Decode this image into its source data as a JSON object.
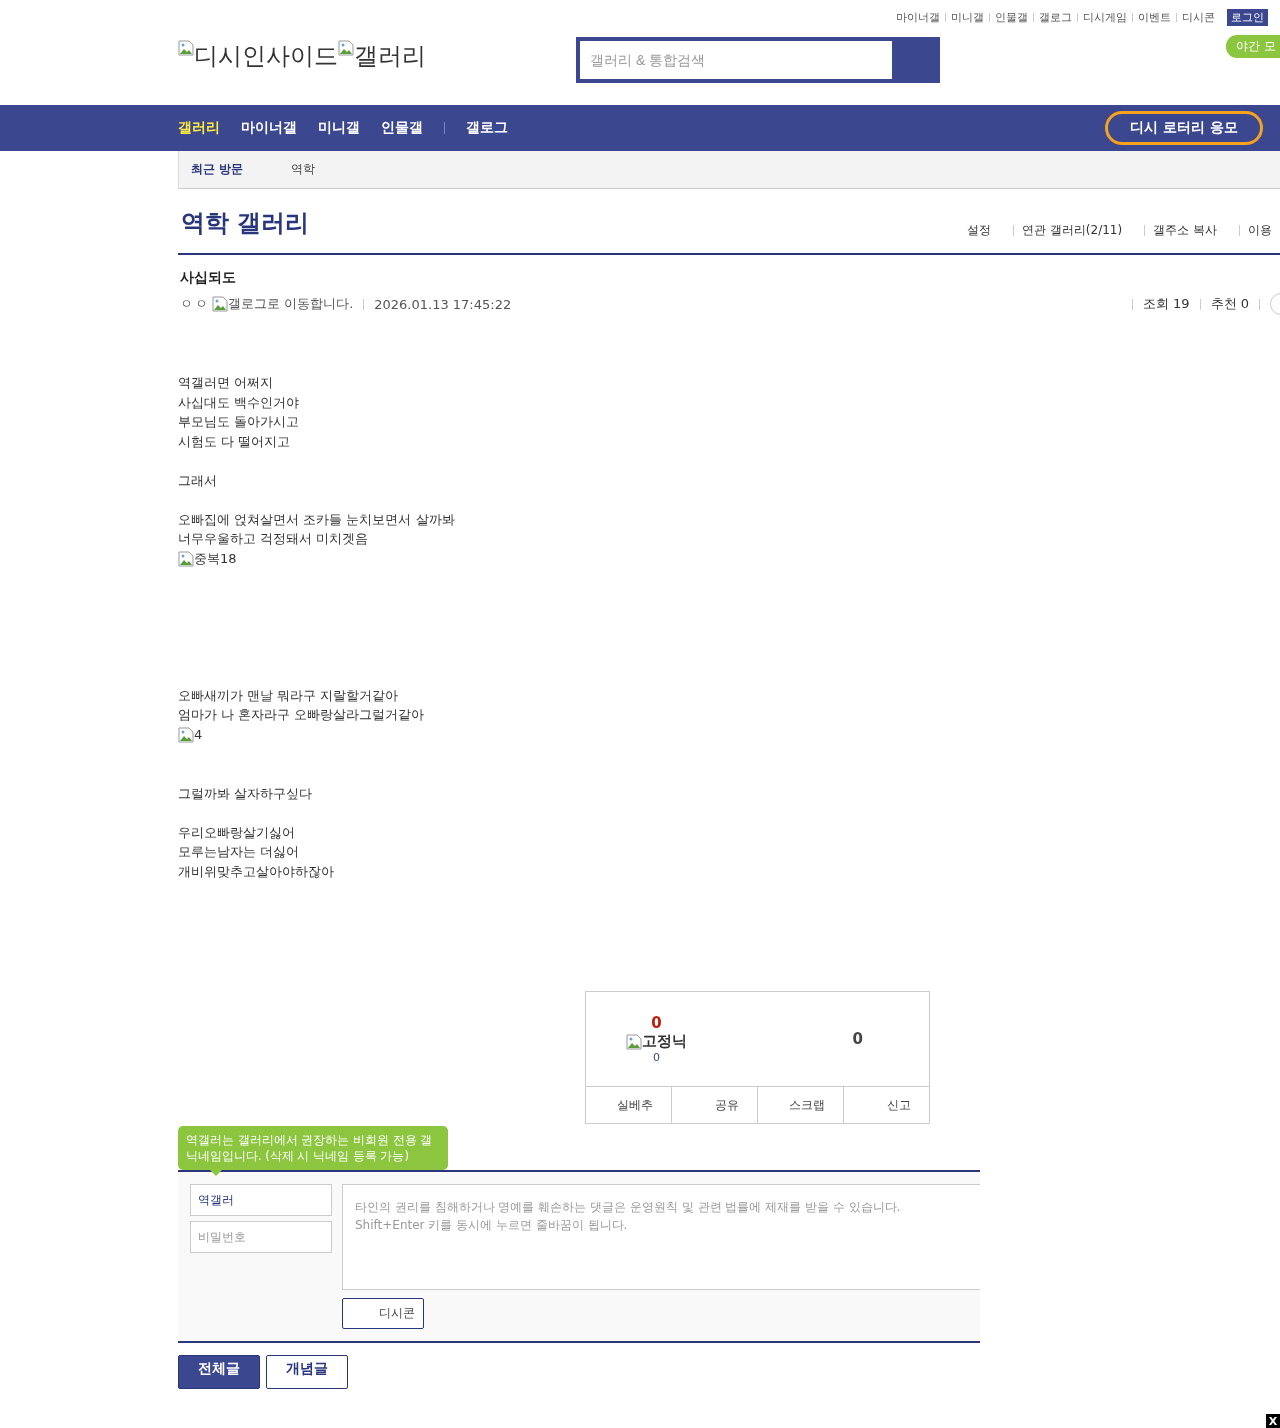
{
  "top_links": [
    "마이너갤",
    "미니갤",
    "인물갤",
    "갤로그",
    "디시게임",
    "이벤트",
    "디시콘"
  ],
  "login": "로그인",
  "night_mode": "야간 모",
  "logo": {
    "site_alt": "디시인사이드",
    "gallery_alt": "갤러리"
  },
  "search": {
    "placeholder": "갤러리 & 통합검색"
  },
  "nav": [
    {
      "label": "갤러리",
      "selected": true
    },
    {
      "label": "마이너갤",
      "selected": false
    },
    {
      "label": "미니갤",
      "selected": false
    },
    {
      "label": "인물갤",
      "selected": false
    },
    {
      "label": "갤로그",
      "selected": false
    }
  ],
  "lottery_button": "디시 로터리 응모",
  "recent": {
    "label": "최근 방문",
    "items": [
      "역학"
    ]
  },
  "gallery_title": "역학 갤러리",
  "gallery_links": [
    "설정",
    "연관 갤러리(2/11)",
    "갤주소 복사",
    "이용"
  ],
  "post": {
    "title": "사십되도",
    "author": "ㅇㅇ",
    "gallog_alt": "갤로그로 이동합니다.",
    "date": "2026.01.13 17:45:22",
    "views": "조회 19",
    "recommends": "추천 0",
    "body": [
      {
        "kind": "text",
        "text": "역갤러면 어쩌지"
      },
      {
        "kind": "text",
        "text": "사십대도 백수인거야"
      },
      {
        "kind": "text",
        "text": "부모님도 돌아가시고"
      },
      {
        "kind": "text",
        "text": "시험도 다 떨어지고"
      },
      {
        "kind": "gap"
      },
      {
        "kind": "text",
        "text": "그래서"
      },
      {
        "kind": "gap"
      },
      {
        "kind": "text",
        "text": "오빠집에 얹쳐살면서 조카들 눈치보면서 살까봐"
      },
      {
        "kind": "text",
        "text": "너무우울하고 걱정돼서 미치겟음"
      },
      {
        "kind": "image",
        "alt": "중복18"
      },
      {
        "kind": "gap"
      },
      {
        "kind": "gap"
      },
      {
        "kind": "gap"
      },
      {
        "kind": "gap"
      },
      {
        "kind": "gap"
      },
      {
        "kind": "gap"
      },
      {
        "kind": "text",
        "text": "오빠새끼가 맨날 뭐라구 지랄할거같아"
      },
      {
        "kind": "text",
        "text": "엄마가 나 혼자라구 오빠랑살라그럴거같아"
      },
      {
        "kind": "image",
        "alt": "4"
      },
      {
        "kind": "gap"
      },
      {
        "kind": "gap"
      },
      {
        "kind": "text",
        "text": "그럴까봐 살자하구싶다"
      },
      {
        "kind": "gap"
      },
      {
        "kind": "text",
        "text": "우리오빠랑살기싫어"
      },
      {
        "kind": "text",
        "text": "모루는남자는 더싫어"
      },
      {
        "kind": "text",
        "text": "개비위맞추고살아야하잖아"
      }
    ]
  },
  "recommend_box": {
    "up_count": "0",
    "fixed_nick_alt": "고정닉",
    "fixed_count": "0",
    "down_count": "0",
    "actions": [
      "실베추",
      "공유",
      "스크랩",
      "신고"
    ]
  },
  "comment": {
    "tooltip": "역갤러는 갤러리에서 권장하는 비회원 전용 갤닉네임입니다. (삭제 시 닉네임 등록 가능)",
    "nickname": "역갤러",
    "password_placeholder": "비밀번호",
    "textarea_placeholder": "타인의 권리를 침해하거나 명예를 훼손하는 댓글은 운영원칙 및 관련 법률에 제재를 받을 수 있습니다.\nShift+Enter 키를 동시에 누르면 줄바꿈이 됩니다.",
    "dccon_button": "디시콘"
  },
  "list_tabs": [
    {
      "label": "전체글",
      "selected": true
    },
    {
      "label": "개념글",
      "selected": false
    }
  ],
  "corner_close": "X"
}
